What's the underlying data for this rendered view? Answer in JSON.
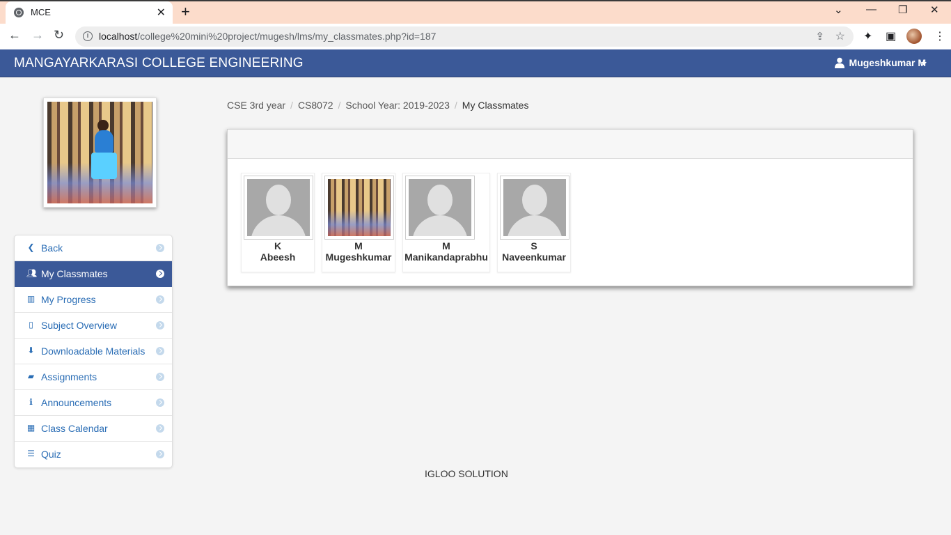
{
  "browser": {
    "tab_title": "MCE",
    "tab_close": "✕",
    "new_tab": "+",
    "url_host": "localhost",
    "url_path": "/college%20mini%20project/mugesh/lms/my_classmates.php?id=187",
    "win_min": "—",
    "win_restore": "❐",
    "win_close": "✕",
    "win_dropdown": "⌄"
  },
  "header": {
    "brand": "MANGAYARKARASI COLLEGE ENGINEERING",
    "user_name": "Mugeshkumar M"
  },
  "sidebar": {
    "items": [
      {
        "label": "Back",
        "icon": "chevron-left-icon",
        "active": false
      },
      {
        "label": "My Classmates",
        "icon": "users-icon",
        "active": true
      },
      {
        "label": "My Progress",
        "icon": "bar-chart-icon",
        "active": false
      },
      {
        "label": "Subject Overview",
        "icon": "file-icon",
        "active": false
      },
      {
        "label": "Downloadable Materials",
        "icon": "download-icon",
        "active": false
      },
      {
        "label": "Assignments",
        "icon": "book-icon",
        "active": false
      },
      {
        "label": "Announcements",
        "icon": "info-icon",
        "active": false
      },
      {
        "label": "Class Calendar",
        "icon": "calendar-icon",
        "active": false
      },
      {
        "label": "Quiz",
        "icon": "list-icon",
        "active": false
      }
    ]
  },
  "breadcrumb": {
    "items": [
      "CSE 3rd year",
      "CS8072",
      "School Year: 2019-2023",
      "My Classmates"
    ],
    "separator": "/"
  },
  "classmates": [
    {
      "initial": "K",
      "name": "Abeesh",
      "photo": "default-avatar"
    },
    {
      "initial": "M",
      "name": "Mugeshkumar",
      "photo": "user-photo"
    },
    {
      "initial": "M",
      "name": "Manikandaprabhu",
      "photo": "default-avatar"
    },
    {
      "initial": "S",
      "name": "Naveenkumar",
      "photo": "default-avatar"
    }
  ],
  "footer": {
    "text": "IGLOO SOLUTION"
  },
  "colors": {
    "brand": "#3b5998",
    "link": "#2a6db5",
    "tabbar": "#fcdccb"
  }
}
